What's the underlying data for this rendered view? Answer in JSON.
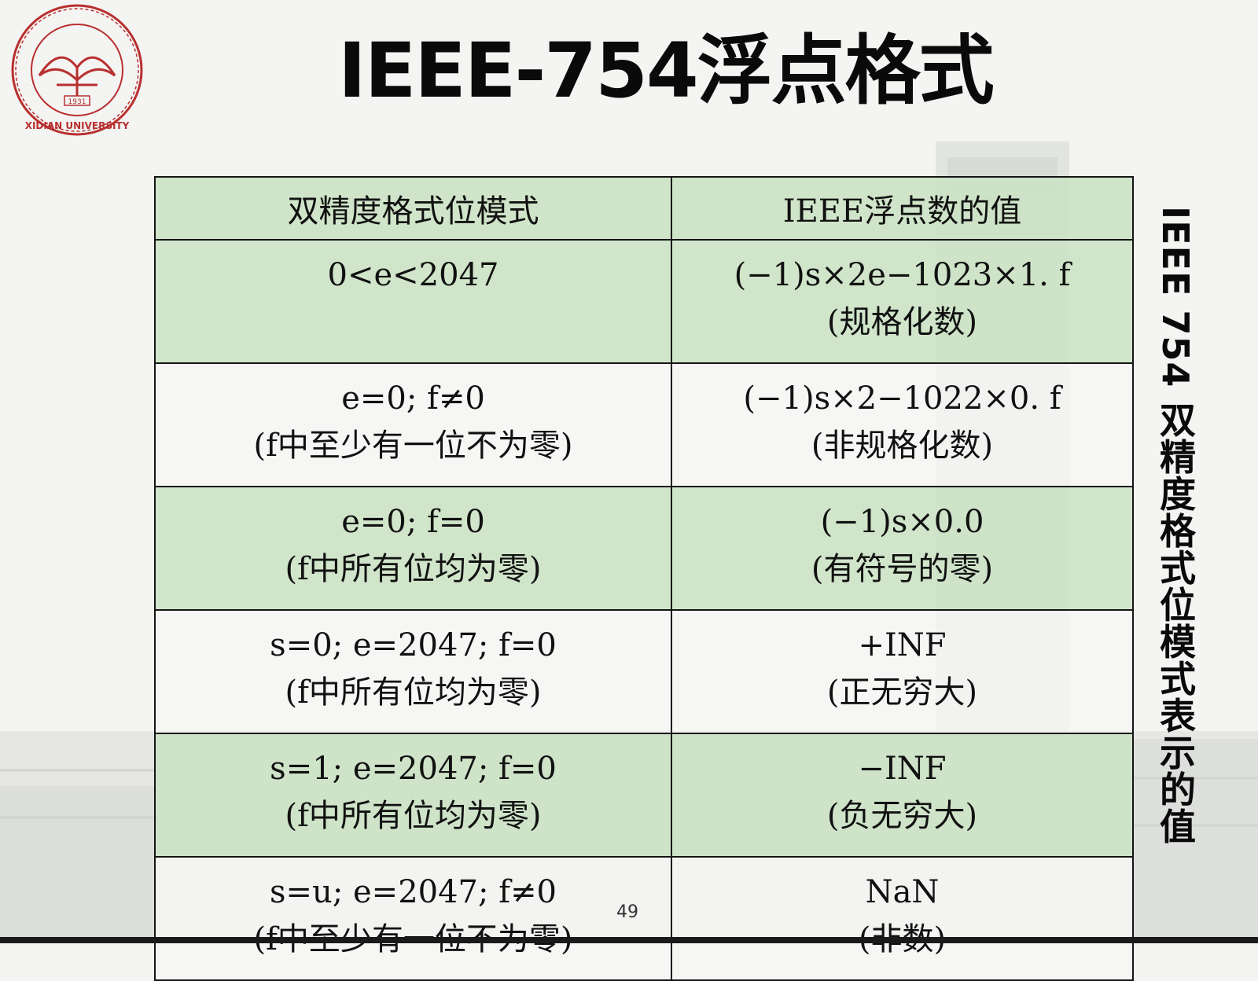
{
  "slide": {
    "title": "IEEE-754浮点格式",
    "side_label": "IEEE 754 双精度格式位模式表示的值",
    "page_number": "49"
  },
  "logo": {
    "seal_text": "西安电子科技大学",
    "english_text": "XIDIAN UNIVERSITY",
    "year": "1931",
    "color": "#b8302f"
  },
  "table": {
    "headers": [
      "双精度格式位模式",
      "IEEE浮点数的值"
    ],
    "rows": [
      {
        "pattern": [
          "0<e<2047"
        ],
        "value": [
          "(−1)s×2e−1023×1. f",
          "(规格化数)"
        ]
      },
      {
        "pattern": [
          "e=0; f≠0",
          "(f中至少有一位不为零)"
        ],
        "value": [
          "(−1)s×2−1022×0. f",
          "(非规格化数)"
        ]
      },
      {
        "pattern": [
          "e=0; f=0",
          "(f中所有位均为零)"
        ],
        "value": [
          "(−1)s×0.0",
          "(有符号的零)"
        ]
      },
      {
        "pattern": [
          "s=0; e=2047; f=0",
          "(f中所有位均为零)"
        ],
        "value": [
          "+INF",
          "(正无穷大)"
        ]
      },
      {
        "pattern": [
          "s=1; e=2047; f=0",
          "(f中所有位均为零)"
        ],
        "value": [
          "−INF",
          "(负无穷大)"
        ]
      },
      {
        "pattern": [
          "s=u; e=2047; f≠0",
          "(f中至少有一位不为零)"
        ],
        "value": [
          "NaN",
          "(非数)"
        ]
      }
    ]
  },
  "colors": {
    "header_fill": "#cbe2c4",
    "shaded_row_fill": "#cbe2c4",
    "border": "#151515"
  }
}
